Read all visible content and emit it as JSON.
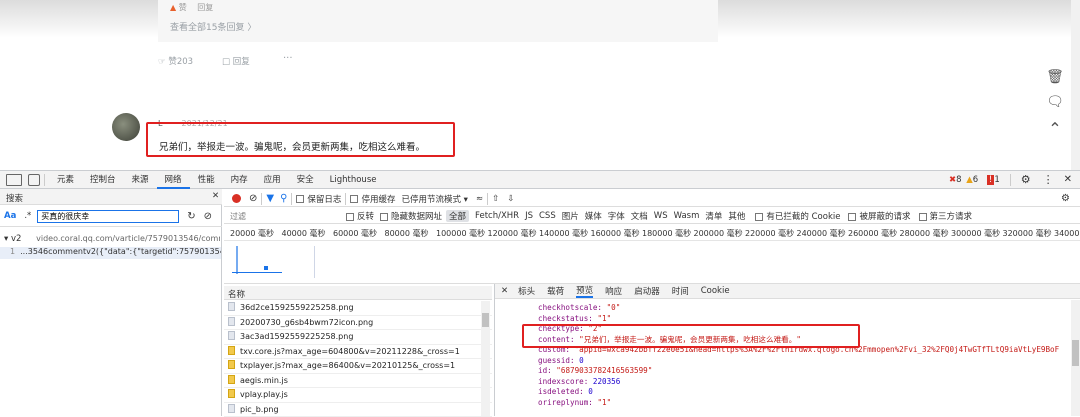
{
  "page": {
    "reply_author": "赞",
    "reply_meta": "回复",
    "view_all": "查看全部15条回复 〉",
    "like_count": "赞203",
    "reply_btn": "回复",
    "more": "···",
    "comment_user": "L·",
    "comment_date": "2021/12/21",
    "comment_text": "兄弟们，举报走一波。骗鬼呢，会员更新两集，吃相这么难看。"
  },
  "devtools": {
    "tabs": [
      "元素",
      "控制台",
      "来源",
      "网络",
      "性能",
      "内存",
      "应用",
      "安全",
      "Lighthouse"
    ],
    "active_tab": "网络",
    "errors": "8",
    "warnings": "6",
    "issues": "1",
    "search_title": "搜索",
    "search_case": "Aa",
    "search_regex": ".*",
    "search_value": "买真的很庆幸",
    "results_group": "v2",
    "results_url": "video.coral.qq.com/varticle/7579013546/commen...",
    "results_line_no": "1",
    "results_line": "...3546commentv2({\"data\":{\"targetid\":7579013546,\"o...",
    "toolbar": {
      "preserve_log": "保留日志",
      "disable_cache": "停用缓存",
      "throttle": "已停用节流模式"
    },
    "filter": {
      "placeholder": "过滤",
      "invert": "反转",
      "hide_data_urls": "隐藏数据网址",
      "types": [
        "全部",
        "Fetch/XHR",
        "JS",
        "CSS",
        "图片",
        "媒体",
        "字体",
        "文档",
        "WS",
        "Wasm",
        "清单",
        "其他"
      ],
      "blocked_cookies": "有已拦截的 Cookie",
      "blocked_requests": "被屏蔽的请求",
      "third_party": "第三方请求"
    },
    "timeline_ticks": [
      "20000 毫秒",
      "40000 毫秒",
      "60000 毫秒",
      "80000 毫秒",
      "100000 毫秒",
      "120000 毫秒",
      "140000 毫秒",
      "160000 毫秒",
      "180000 毫秒",
      "200000 毫秒",
      "220000 毫秒",
      "240000 毫秒",
      "260000 毫秒",
      "280000 毫秒",
      "300000 毫秒",
      "320000 毫秒",
      "340000 毫"
    ],
    "name_header": "名称",
    "files": [
      {
        "name": "36d2ce1592559225258.png",
        "icon": "image"
      },
      {
        "name": "20200730_g6sb4bwm72icon.png",
        "icon": "image"
      },
      {
        "name": "3ac3ad1592559225258.png",
        "icon": "image"
      },
      {
        "name": "txv.core.js?max_age=604800&v=20211228&_cross=1",
        "icon": "script"
      },
      {
        "name": "txplayer.js?max_age=86400&v=20210125&_cross=1",
        "icon": "script"
      },
      {
        "name": "aegis.min.js",
        "icon": "script"
      },
      {
        "name": "vplay.play.js",
        "icon": "script"
      },
      {
        "name": "pic_b.png",
        "icon": "image"
      }
    ],
    "detail_tabs": [
      "标头",
      "载荷",
      "预览",
      "响应",
      "启动器",
      "时间",
      "Cookie"
    ],
    "active_detail_tab": "预览",
    "preview": [
      {
        "key": "checkhotscale",
        "value": "\"0\"",
        "kind": "s"
      },
      {
        "key": "checkstatus",
        "value": "\"1\"",
        "kind": "s"
      },
      {
        "key": "checktype",
        "value": "\"2\"",
        "kind": "s"
      },
      {
        "key": "content",
        "value": "\"兄弟们，举报走一波。骗鬼呢，会员更新两集，吃相这么难看。\"",
        "kind": "s"
      },
      {
        "key": "custom",
        "value": "\"appid=wxca942bbff22e0e51&head=https%3A%2F%2Fthirdwx.qlogo.cn%2Fmmopen%2Fvi_32%2FQ0j4TwGTfTLtQ9iaVtLyE9BoF",
        "kind": "s"
      },
      {
        "key": "guessid",
        "value": "0",
        "kind": "n"
      },
      {
        "key": "id",
        "value": "\"6879033782416563599\"",
        "kind": "s"
      },
      {
        "key": "indexscore",
        "value": "220356",
        "kind": "n"
      },
      {
        "key": "isdeleted",
        "value": "0",
        "kind": "n"
      },
      {
        "key": "orireplynum",
        "value": "\"1\"",
        "kind": "s"
      }
    ],
    "colors": {
      "accent": "#1a73e8",
      "record": "#d93025",
      "highlight_box": "#e02020"
    }
  }
}
